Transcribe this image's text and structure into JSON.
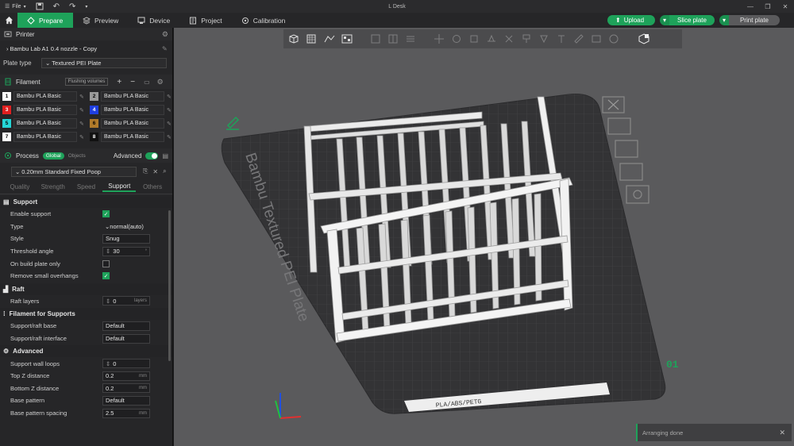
{
  "titlebar": {
    "file_label": "File",
    "title": "L Desk"
  },
  "nav": {
    "tabs": [
      {
        "label": "Prepare",
        "active": true
      },
      {
        "label": "Preview",
        "active": false
      },
      {
        "label": "Device",
        "active": false
      },
      {
        "label": "Project",
        "active": false
      },
      {
        "label": "Calibration",
        "active": false
      }
    ],
    "upload_label": "Upload",
    "slice_label": "Slice plate",
    "print_label": "Print plate"
  },
  "printer": {
    "section_label": "Printer",
    "selected": "Bambu Lab A1 0.4 nozzle - Copy",
    "plate_type_label": "Plate type",
    "plate_type_value": "Textured PEI Plate"
  },
  "filament": {
    "section_label": "Filament",
    "flushing_label": "Flushing volumes",
    "items": [
      {
        "num": "1",
        "name": "Bambu PLA Basic",
        "color": "#ffffff"
      },
      {
        "num": "2",
        "name": "Bambu PLA Basic",
        "color": "#9a9a9a"
      },
      {
        "num": "3",
        "name": "Bambu PLA Basic",
        "color": "#e02020"
      },
      {
        "num": "4",
        "name": "Bambu PLA Basic",
        "color": "#1f3fe0"
      },
      {
        "num": "5",
        "name": "Bambu PLA Basic",
        "color": "#25d6d6"
      },
      {
        "num": "6",
        "name": "Bambu PLA Basic",
        "color": "#b07a2a"
      },
      {
        "num": "7",
        "name": "Bambu PLA Basic",
        "color": "#ffffff"
      },
      {
        "num": "8",
        "name": "Bambu PLA Basic",
        "color": "#111111"
      }
    ]
  },
  "process": {
    "section_label": "Process",
    "global_label": "Global",
    "objects_label": "Objects",
    "advanced_label": "Advanced",
    "preset": "0.20mm Standard Fixed Poop",
    "tabs": [
      "Quality",
      "Strength",
      "Speed",
      "Support",
      "Others"
    ],
    "active_tab": "Support"
  },
  "support": {
    "group_support": "Support",
    "enable_support_label": "Enable support",
    "enable_support": true,
    "type_label": "Type",
    "type_value": "normal(auto)",
    "style_label": "Style",
    "style_value": "Snug",
    "threshold_label": "Threshold angle",
    "threshold_value": "30",
    "build_plate_only_label": "On build plate only",
    "build_plate_only": false,
    "remove_small_label": "Remove small overhangs",
    "remove_small": true,
    "group_raft": "Raft",
    "raft_layers_label": "Raft layers",
    "raft_layers_value": "0",
    "raft_layers_unit": "layers",
    "group_filament": "Filament for Supports",
    "raft_base_label": "Support/raft base",
    "raft_base_value": "Default",
    "raft_interface_label": "Support/raft interface",
    "raft_interface_value": "Default",
    "group_advanced": "Advanced",
    "wall_loops_label": "Support wall loops",
    "wall_loops_value": "0",
    "top_z_label": "Top Z distance",
    "top_z_value": "0.2",
    "top_z_unit": "mm",
    "bottom_z_label": "Bottom Z distance",
    "bottom_z_value": "0.2",
    "bottom_z_unit": "mm",
    "base_pattern_label": "Base pattern",
    "base_pattern_value": "Default",
    "base_spacing_label": "Base pattern spacing",
    "base_spacing_value": "2.5",
    "base_spacing_unit": "mm"
  },
  "viewport": {
    "plate_text": "Bambu Textured PEI Plate",
    "plate_number": "01",
    "plate_label": "PLA/ABS/PETG",
    "toast": "Arranging done"
  }
}
